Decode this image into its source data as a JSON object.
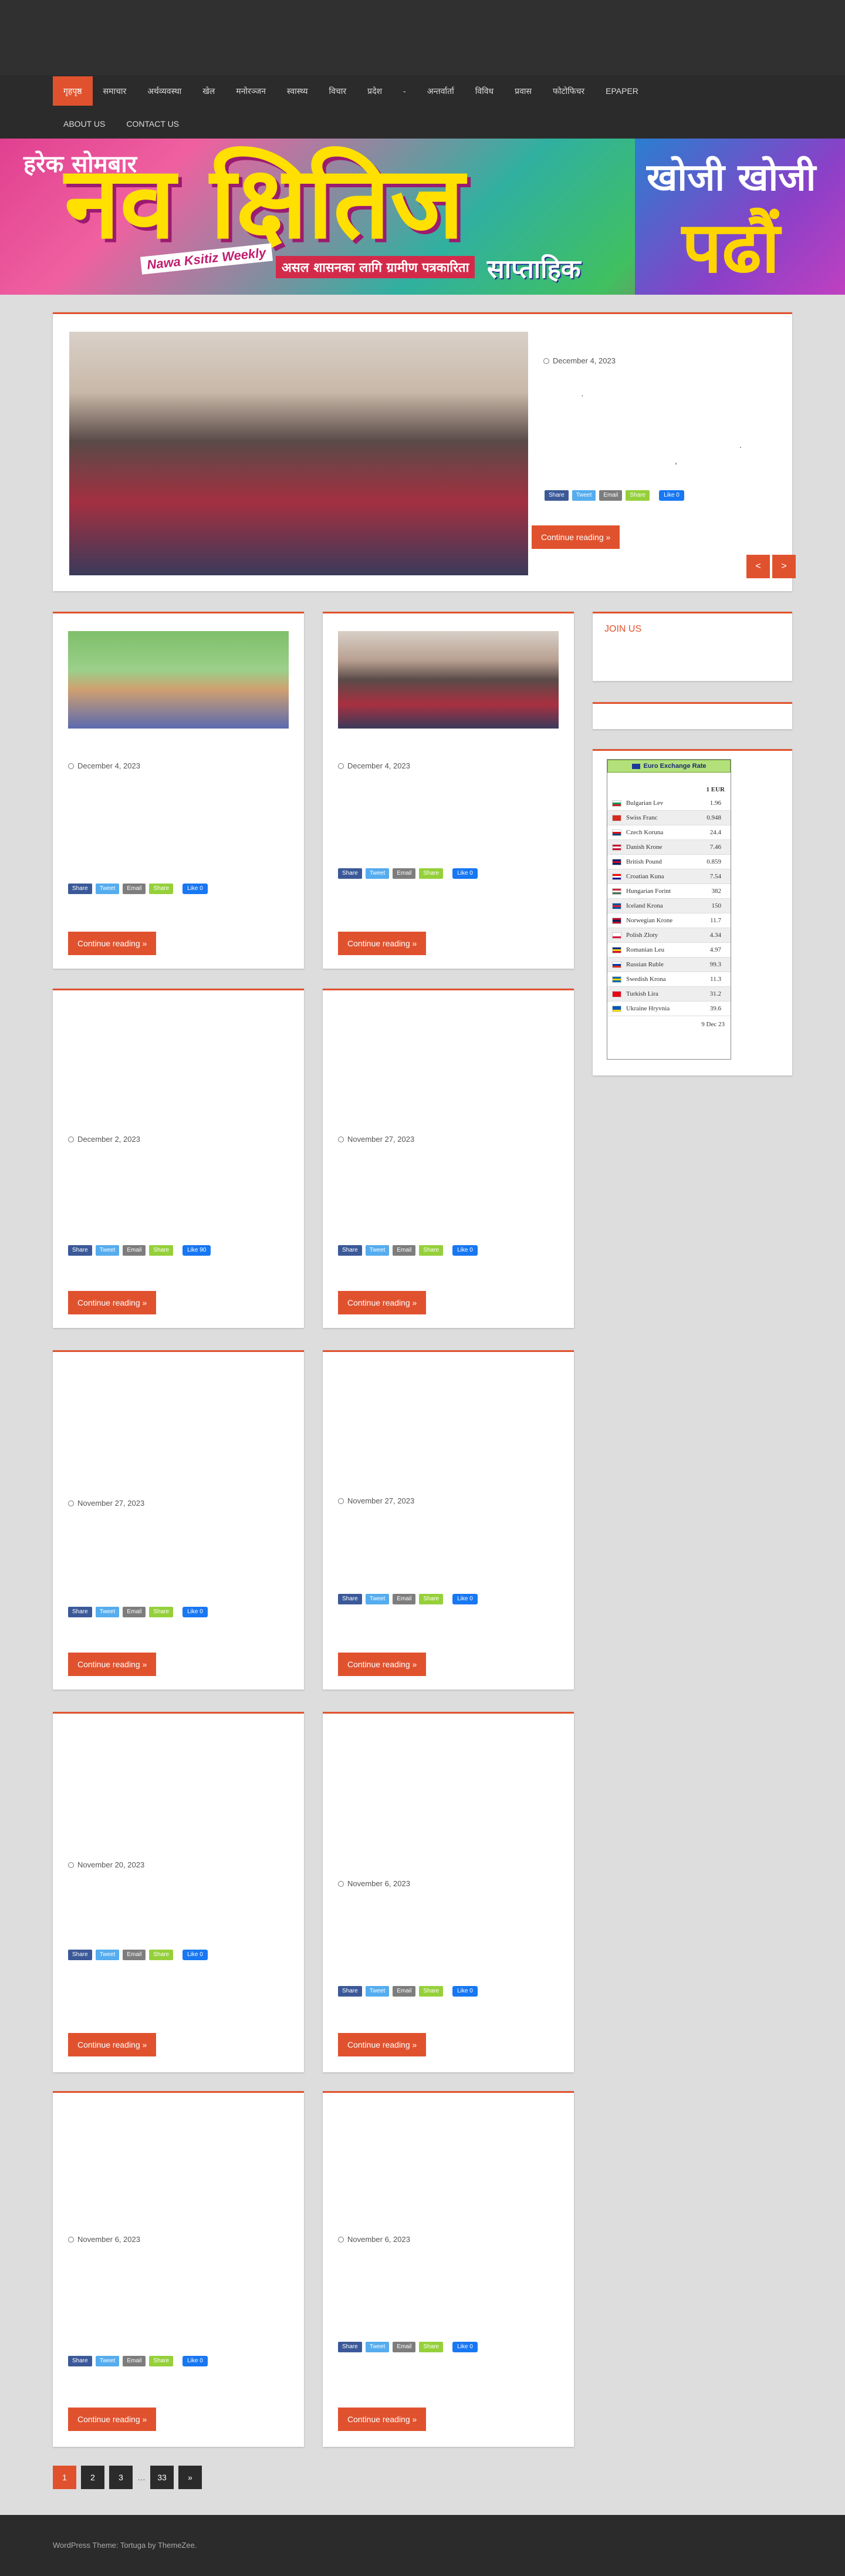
{
  "nav": {
    "row1": [
      "गृहपृष्ठ",
      "समाचार",
      "अर्थव्यवस्था",
      "खेल",
      "मनोरञ्जन",
      "स्वास्थ्य",
      "विचार",
      "प्रदेश",
      "-",
      "अन्तर्वार्ता",
      "विविध",
      "प्रवास",
      "फोटोफिचर",
      "EPAPER"
    ],
    "row2": [
      "ABOUT US",
      "CONTACT US"
    ]
  },
  "banner": {
    "weekday": "हरेक सोमबार",
    "title": "नव क्षितिज",
    "english": "Nawa Ksitiz Weekly",
    "tagline": "असल शासनका लागि ग्रामीण पत्रकारिता",
    "weekly": "साप्ताहिक",
    "right_line1": "खोजी खोजी",
    "right_line2": "पढौं"
  },
  "featured": {
    "date": "December 4, 2023",
    "button": "Continue reading »",
    "prev": "<",
    "next": ">"
  },
  "share": {
    "fb": "Share",
    "tw": "Tweet",
    "em": "Email",
    "sh": "Share",
    "like": "Like 0",
    "like_alt": "Like 90"
  },
  "posts": [
    {
      "date": "December 4, 2023",
      "button": "Continue reading »"
    },
    {
      "date": "December 4, 2023",
      "button": "Continue reading »"
    },
    {
      "date": "December 2, 2023",
      "button": "Continue reading »"
    },
    {
      "date": "November 27, 2023",
      "button": "Continue reading »"
    },
    {
      "date": "November 27, 2023",
      "button": "Continue reading »"
    },
    {
      "date": "November 27, 2023",
      "button": "Continue reading »"
    },
    {
      "date": "November 20, 2023",
      "button": "Continue reading »"
    },
    {
      "date": "November 6, 2023",
      "button": "Continue reading »"
    },
    {
      "date": "November 6, 2023",
      "button": "Continue reading »"
    },
    {
      "date": "November 6, 2023",
      "button": "Continue reading »"
    }
  ],
  "sidebar": {
    "join_title": "JOIN US",
    "fx_title": "Euro Exchange Rate",
    "fx_unit": "1 EUR",
    "fx_date": "9 Dec 23",
    "fx_rows": [
      {
        "name": "Bulgarian Lev",
        "value": "1.96",
        "colors": [
          "#fff",
          "#0a9a5a",
          "#d01c1f"
        ]
      },
      {
        "name": "Swiss Franc",
        "value": "0.948",
        "colors": [
          "#d52b1e",
          "#d52b1e",
          "#d52b1e"
        ]
      },
      {
        "name": "Czech Koruna",
        "value": "24.4",
        "colors": [
          "#fff",
          "#d7141a",
          "#11457e"
        ]
      },
      {
        "name": "Danish Krone",
        "value": "7.46",
        "colors": [
          "#c8102e",
          "#fff",
          "#c8102e"
        ]
      },
      {
        "name": "British Pound",
        "value": "0.859",
        "colors": [
          "#012169",
          "#c8102e",
          "#012169"
        ]
      },
      {
        "name": "Croatian Kuna",
        "value": "7.54",
        "colors": [
          "#ff0000",
          "#fff",
          "#171796"
        ]
      },
      {
        "name": "Hungarian Forint",
        "value": "382",
        "colors": [
          "#cd2a3e",
          "#fff",
          "#436f4d"
        ]
      },
      {
        "name": "Iceland Krona",
        "value": "150",
        "colors": [
          "#02529c",
          "#dc1e35",
          "#02529c"
        ]
      },
      {
        "name": "Norwegian Krone",
        "value": "11.7",
        "colors": [
          "#ba0c2f",
          "#00205b",
          "#ba0c2f"
        ]
      },
      {
        "name": "Polish Zloty",
        "value": "4.34",
        "colors": [
          "#fff",
          "#fff",
          "#dc143c"
        ]
      },
      {
        "name": "Romanian Leu",
        "value": "4.97",
        "colors": [
          "#002b7f",
          "#fcd116",
          "#ce1126"
        ]
      },
      {
        "name": "Russian Ruble",
        "value": "99.3",
        "colors": [
          "#fff",
          "#0039a6",
          "#d52b1e"
        ]
      },
      {
        "name": "Swedish Krona",
        "value": "11.3",
        "colors": [
          "#006aa7",
          "#fecc00",
          "#006aa7"
        ]
      },
      {
        "name": "Turkish Lira",
        "value": "31.2",
        "colors": [
          "#e30a17",
          "#e30a17",
          "#e30a17"
        ]
      },
      {
        "name": "Ukraine Hryvnia",
        "value": "39.6",
        "colors": [
          "#0057b7",
          "#0057b7",
          "#ffd700"
        ]
      }
    ]
  },
  "pagination": [
    "1",
    "2",
    "3",
    "…",
    "33",
    "»"
  ],
  "footer": "WordPress Theme: Tortuga by ThemeZee."
}
